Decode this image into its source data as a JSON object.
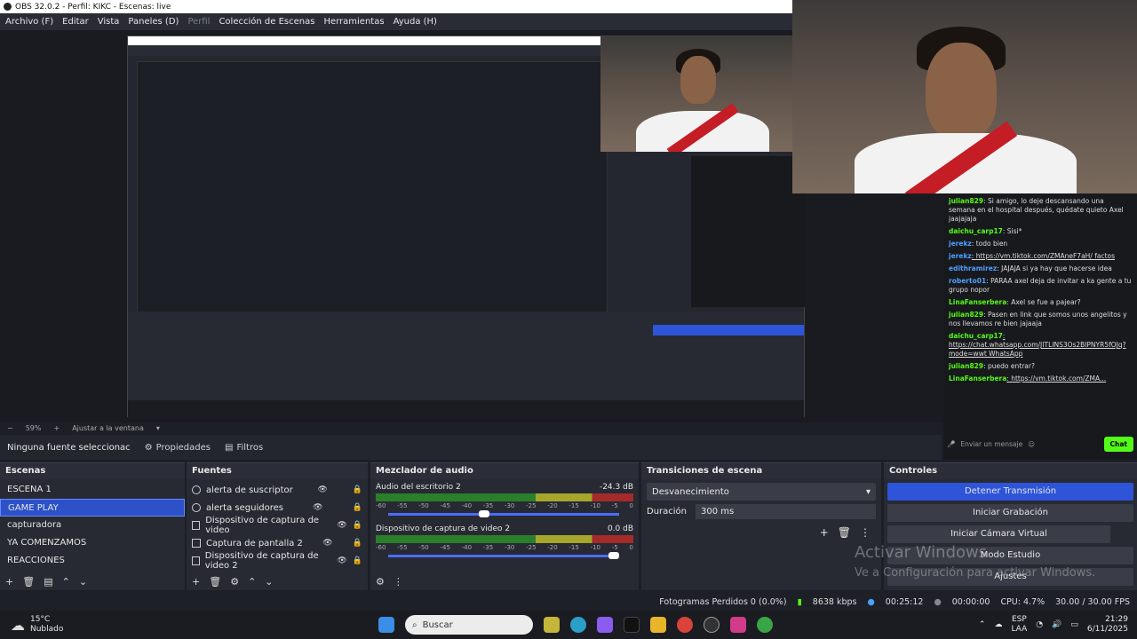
{
  "window": {
    "title": "OBS 32.0.2 - Perfil: KIKC - Escenas: live"
  },
  "menu": [
    {
      "label": "Archivo (F)",
      "enabled": true
    },
    {
      "label": "Editar",
      "enabled": true
    },
    {
      "label": "Vista",
      "enabled": true
    },
    {
      "label": "Paneles (D)",
      "enabled": true
    },
    {
      "label": "Perfil",
      "enabled": false
    },
    {
      "label": "Colección de Escenas",
      "enabled": true
    },
    {
      "label": "Herramientas",
      "enabled": true
    },
    {
      "label": "Ayuda (H)",
      "enabled": true
    }
  ],
  "chat": {
    "messages": [
      {
        "user": "julian829",
        "text": ": Si amigo, lo deje descansando una semana en el hospital después, quédate quieto Axel jaajajaja"
      },
      {
        "user": "daichu_carp17",
        "text": ": Sisi*"
      },
      {
        "user": "jerekz",
        "text": ": todo bien"
      },
      {
        "user": "jerekz",
        "text": ": https://vm.tiktok.com/ZMAneF7aH/ factos"
      },
      {
        "user": "edithramirez",
        "text": ": JAJAJA si ya hay que hacerse idea"
      },
      {
        "user": "roberto01",
        "text": ": PARAA axel deja de invitar a ka gente a tu grupo nopor"
      },
      {
        "user": "LinaFanserbera",
        "text": ": Axel se fue a pajear?"
      },
      {
        "user": "julian829",
        "text": ": Pasen en link que somos unos angelitos y nos llevamos re bien jajaaja"
      },
      {
        "user": "daichu_carp17",
        "text": ": https://chat.whatsapp.com/JITLINS3Os2BlPNYR5fOJq?mode=wwt WhatsApp"
      },
      {
        "user": "julian829",
        "text": ": puedo entrar?"
      },
      {
        "user": "LinaFanserbera",
        "text": ": https://vm.tiktok.com/ZMA..."
      }
    ],
    "input_placeholder": "Enviar un mensaje",
    "send_label": "Chat"
  },
  "preview": {
    "zoom": "59%",
    "fit_label": "Ajustar a la ventana"
  },
  "source_bar": {
    "no_source": "Ninguna fuente seleccionac",
    "properties": "Propiedades",
    "filters": "Filtros"
  },
  "scenes": {
    "title": "Escenas",
    "items": [
      "ESCENA 1",
      "GAME PLAY",
      "capturadora",
      "YA COMENZAMOS",
      "REACCIONES"
    ],
    "selected_index": 1
  },
  "sources": {
    "title": "Fuentes",
    "items": [
      "alerta de suscriptor",
      "alerta seguidores",
      "Dispositivo de captura de video",
      "Captura de pantalla 2",
      "Dispositivo de captura de video 2"
    ]
  },
  "mixer": {
    "title": "Mezclador de audio",
    "channels": [
      {
        "name": "Audio del escritorio 2",
        "db": "-24.3 dB",
        "level": 0.78
      },
      {
        "name": "Dispositivo de captura de video 2",
        "db": "0.0 dB",
        "level": 1.0
      }
    ],
    "ticks": [
      "-60",
      "-55",
      "-50",
      "-45",
      "-40",
      "-35",
      "-30",
      "-25",
      "-20",
      "-15",
      "-10",
      "-5",
      "0"
    ]
  },
  "transitions": {
    "title": "Transiciones de escena",
    "selected": "Desvanecimiento",
    "duration_label": "Duración",
    "duration_value": "300 ms"
  },
  "controls": {
    "title": "Controles",
    "buttons": [
      "Detener Transmisión",
      "Iniciar Grabación",
      "Iniciar Cámara Virtual",
      "Modo Estudio",
      "Ajustes"
    ]
  },
  "watermark": {
    "line1": "Activar Windows",
    "line2": "Ve a Configuración para activar Windows."
  },
  "status": {
    "dropped": "Fotogramas Perdidos 0 (0.0%)",
    "bitrate": "8638 kbps",
    "stream_time": "00:25:12",
    "rec_time": "00:00:00",
    "cpu": "CPU: 4.7%",
    "fps": "30.00 / 30.00 FPS"
  },
  "taskbar": {
    "weather_temp": "15°C",
    "weather_desc": "Nublado",
    "search": "Buscar",
    "lang1": "ESP",
    "lang2": "LAA",
    "time": "21:29",
    "date": "6/11/2025"
  },
  "colors": {
    "accent": "#2d54d9",
    "kick": "#53fc18"
  }
}
